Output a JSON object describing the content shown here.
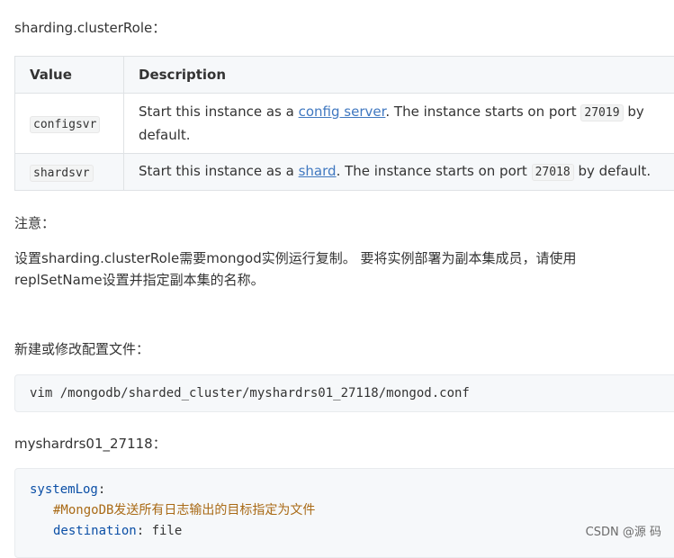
{
  "heading_param": "sharding.clusterRole：",
  "table": {
    "headers": [
      "Value",
      "Description"
    ],
    "rows": [
      {
        "value": "configsvr",
        "desc_pre": "Start this instance as a ",
        "desc_link": "config server",
        "desc_mid": ". The instance starts on port ",
        "port": "27019",
        "desc_post": " by default."
      },
      {
        "value": "shardsvr",
        "desc_pre": "Start this instance as a ",
        "desc_link": "shard",
        "desc_mid": ". The instance starts on port ",
        "port": "27018",
        "desc_post": " by default."
      }
    ]
  },
  "note_label": "注意：",
  "note_line1": "设置sharding.clusterRole需要mongod实例运行复制。 要将实例部署为副本集成员，请使用",
  "note_line2": "replSetName设置并指定副本集的名称。",
  "create_label": "新建或修改配置文件：",
  "command": "vim /mongodb/sharded_cluster/myshardrs01_27118/mongod.conf",
  "file_label": "myshardrs01_27118：",
  "config": {
    "line1_key": "systemLog",
    "line1_colon": ":",
    "line2_comment": "#MongoDB发送所有日志输出的目标指定为文件",
    "line3_key": "destination",
    "line3_value": ": file"
  },
  "footer_watermark": "CSDN @源 码"
}
